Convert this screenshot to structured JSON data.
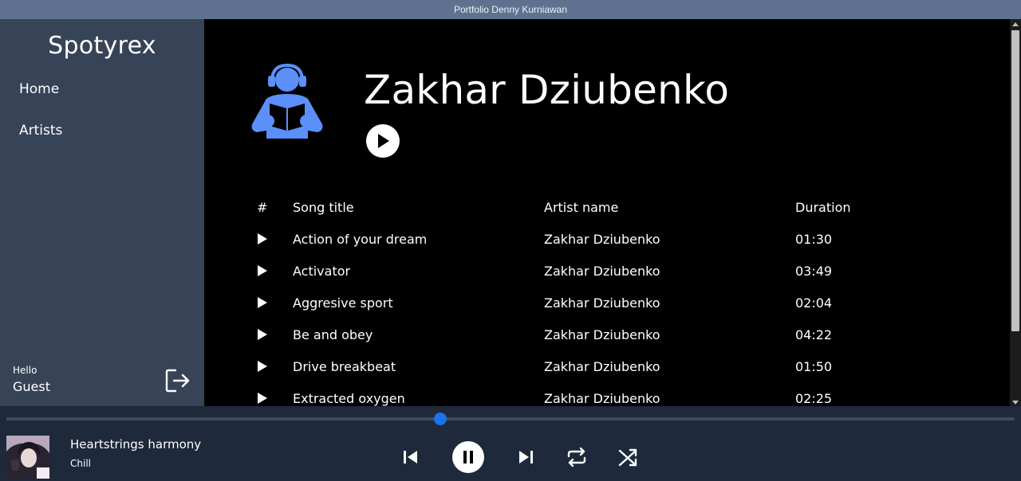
{
  "window": {
    "title": "Portfolio Denny Kurniawan"
  },
  "sidebar": {
    "brand": "Spotyrex",
    "nav": [
      {
        "label": "Home"
      },
      {
        "label": "Artists"
      }
    ],
    "greeting": "Hello",
    "user": "Guest",
    "logout_icon": "logout-icon"
  },
  "artist": {
    "name": "Zakhar Dziubenko",
    "icon": "person-reading-with-headphones-icon",
    "accent_color": "#5b8ff9"
  },
  "table": {
    "headers": {
      "num": "#",
      "title": "Song title",
      "artist": "Artist name",
      "duration": "Duration"
    },
    "rows": [
      {
        "title": "Action of your dream",
        "artist": "Zakhar Dziubenko",
        "duration": "01:30"
      },
      {
        "title": "Activator",
        "artist": "Zakhar Dziubenko",
        "duration": "03:49"
      },
      {
        "title": "Aggresive sport",
        "artist": "Zakhar Dziubenko",
        "duration": "02:04"
      },
      {
        "title": "Be and obey",
        "artist": "Zakhar Dziubenko",
        "duration": "04:22"
      },
      {
        "title": "Drive breakbeat",
        "artist": "Zakhar Dziubenko",
        "duration": "01:50"
      },
      {
        "title": "Extracted oxygen",
        "artist": "Zakhar Dziubenko",
        "duration": "02:25"
      }
    ]
  },
  "player": {
    "track_title": "Heartstrings harmony",
    "track_genre": "Chill",
    "progress_percent": 43,
    "knob_color": "#1a73e8",
    "state": "playing",
    "controls": [
      "previous-icon",
      "pause-icon",
      "next-icon",
      "repeat-icon",
      "shuffle-icon"
    ]
  }
}
